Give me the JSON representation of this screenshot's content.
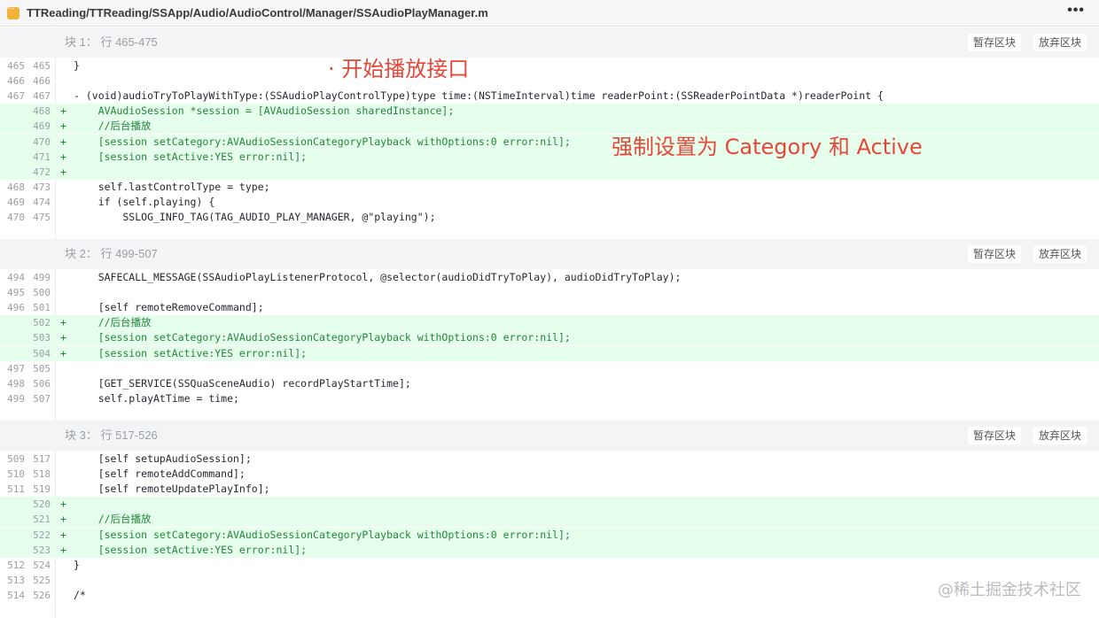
{
  "file": {
    "path": "TTReading/TTReading/SSApp/Audio/AudioControl/Manager/SSAudioPlayManager.m",
    "more_label": "•••"
  },
  "hunk_buttons": {
    "stage": "暂存区块",
    "discard": "放弃区块"
  },
  "hunks": [
    {
      "title": "块 1： 行 465-475",
      "lines": [
        {
          "old": "465",
          "new": "465",
          "type": "ctx",
          "code": "}"
        },
        {
          "old": "466",
          "new": "466",
          "type": "ctx",
          "code": ""
        },
        {
          "old": "467",
          "new": "467",
          "type": "ctx",
          "code": "- (void)audioTryToPlayWithType:(SSAudioPlayControlType)type time:(NSTimeInterval)time readerPoint:(SSReaderPointData *)readerPoint {"
        },
        {
          "old": "",
          "new": "468",
          "type": "add",
          "code": "    AVAudioSession *session = [AVAudioSession sharedInstance];"
        },
        {
          "old": "",
          "new": "469",
          "type": "add",
          "code": "    //后台播放"
        },
        {
          "old": "",
          "new": "470",
          "type": "add",
          "code": "    [session setCategory:AVAudioSessionCategoryPlayback withOptions:0 error:nil];"
        },
        {
          "old": "",
          "new": "471",
          "type": "add",
          "code": "    [session setActive:YES error:nil];"
        },
        {
          "old": "",
          "new": "472",
          "type": "add",
          "code": ""
        },
        {
          "old": "468",
          "new": "473",
          "type": "ctx",
          "code": "    self.lastControlType = type;"
        },
        {
          "old": "469",
          "new": "474",
          "type": "ctx",
          "code": "    if (self.playing) {"
        },
        {
          "old": "470",
          "new": "475",
          "type": "ctx",
          "code": "        SSLOG_INFO_TAG(TAG_AUDIO_PLAY_MANAGER, @\"playing\");"
        }
      ]
    },
    {
      "title": "块 2： 行 499-507",
      "lines": [
        {
          "old": "494",
          "new": "499",
          "type": "ctx",
          "code": "    SAFECALL_MESSAGE(SSAudioPlayListenerProtocol, @selector(audioDidTryToPlay), audioDidTryToPlay);"
        },
        {
          "old": "495",
          "new": "500",
          "type": "ctx",
          "code": ""
        },
        {
          "old": "496",
          "new": "501",
          "type": "ctx",
          "code": "    [self remoteRemoveCommand];"
        },
        {
          "old": "",
          "new": "502",
          "type": "add",
          "code": "    //后台播放"
        },
        {
          "old": "",
          "new": "503",
          "type": "add",
          "code": "    [session setCategory:AVAudioSessionCategoryPlayback withOptions:0 error:nil];"
        },
        {
          "old": "",
          "new": "504",
          "type": "add",
          "code": "    [session setActive:YES error:nil];"
        },
        {
          "old": "497",
          "new": "505",
          "type": "ctx",
          "code": ""
        },
        {
          "old": "498",
          "new": "506",
          "type": "ctx",
          "code": "    [GET_SERVICE(SSQuaSceneAudio) recordPlayStartTime];"
        },
        {
          "old": "499",
          "new": "507",
          "type": "ctx",
          "code": "    self.playAtTime = time;"
        }
      ]
    },
    {
      "title": "块 3： 行 517-526",
      "lines": [
        {
          "old": "509",
          "new": "517",
          "type": "ctx",
          "code": "    [self setupAudioSession];"
        },
        {
          "old": "510",
          "new": "518",
          "type": "ctx",
          "code": "    [self remoteAddCommand];"
        },
        {
          "old": "511",
          "new": "519",
          "type": "ctx",
          "code": "    [self remoteUpdatePlayInfo];"
        },
        {
          "old": "",
          "new": "520",
          "type": "add",
          "code": ""
        },
        {
          "old": "",
          "new": "521",
          "type": "add",
          "code": "    //后台播放"
        },
        {
          "old": "",
          "new": "522",
          "type": "add",
          "code": "    [session setCategory:AVAudioSessionCategoryPlayback withOptions:0 error:nil];"
        },
        {
          "old": "",
          "new": "523",
          "type": "add",
          "code": "    [session setActive:YES error:nil];"
        },
        {
          "old": "512",
          "new": "524",
          "type": "ctx",
          "code": "}"
        },
        {
          "old": "513",
          "new": "525",
          "type": "ctx",
          "code": ""
        },
        {
          "old": "514",
          "new": "526",
          "type": "ctx",
          "code": "/*"
        }
      ]
    }
  ],
  "annotations": {
    "start_play": "·  开始播放接口",
    "force_set": "强制设置为 Category 和 Active"
  },
  "watermark": "@稀土掘金技术社区",
  "colors": {
    "added_bg": "#e6ffed",
    "added_text": "#22863a",
    "annotation": "#e5473b"
  }
}
